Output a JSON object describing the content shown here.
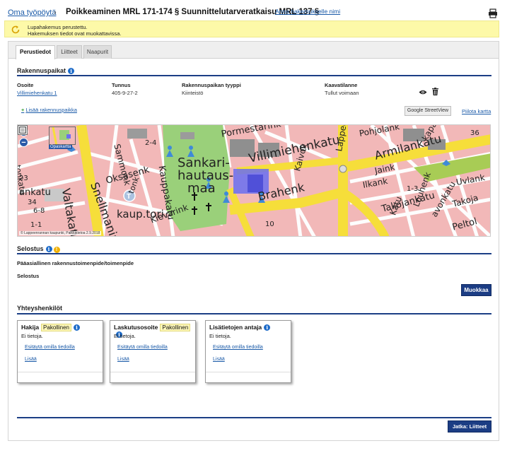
{
  "header": {
    "breadcrumb_label": "Oma työpöytä",
    "breadcrumb_sep": "›",
    "title": "Poikkeaminen MRL 171-174 § Suunnittelutarveratkaisu MRL 137 §",
    "rename_link": "Anna hakemukselle nimi",
    "print_icon": "printer-icon"
  },
  "notice": {
    "icon": "refresh-icon",
    "line1": "Lupahakemus perustettu.",
    "line2": "Hakemuksen tiedot ovat muokattavissa.",
    "background": "#fdf9a8"
  },
  "tabs": [
    {
      "label": "Perustiedot",
      "active": true
    },
    {
      "label": "Liitteet",
      "active": false
    },
    {
      "label": "Naapurit",
      "active": false
    }
  ],
  "rakennuspaikat": {
    "title": "Rakennuspaikat",
    "columns": [
      "Osoite",
      "Tunnus",
      "Rakennuspaikan tyyppi",
      "Kaavatilanne"
    ],
    "row": {
      "osoite": "Villimiehenkatu 1",
      "tunnus": "405-9-27-2",
      "tyyppi": "Kiinteistö",
      "kaava": "Tullut voimaan"
    },
    "add_link": "Lisää rakennuspaikka",
    "streetview_button": "Google StreetView",
    "hide_map_link": "Piilota kartta"
  },
  "map": {
    "overview_label": "Opaskartta",
    "credit": "© Lappeenrannan kaupunki, Paikkatietoa 2.9.2018",
    "labels": {
      "sankari": "Sankari-",
      "hautaus": "hautaus-",
      "maa": "maa",
      "villimiehenkatu": "Villimiehenkatu",
      "armilankatu": "Armilankatu",
      "brahenk": "Brahenk",
      "snellmanink": "Snellmanink",
      "valtakatu": "Valtakatu",
      "kauppakatu": "Kauppakatu",
      "pormestarink": "Pormestarink",
      "oksasenk": "Oksasenk",
      "kievarink": "Kievarink",
      "kauptori": "kaup.tori",
      "sammonk": "Sammonk",
      "lappee": "Lappee",
      "takojankatu": "Takojankatu",
      "ilkank": "Ilkank",
      "louhenk": "Louhenk",
      "kaivok": "Kaivok",
      "pohjolank": "Pohjolank",
      "kapakatu": "kapakatu",
      "ankatu": "ankatu",
      "peltolank": "Peltol",
      "luvlankatu": "Uvlank",
      "jaink": "Jaink",
      "takojanku": "Takoja",
      "katu": "Katu",
      "savonkatu": "avonkatu",
      "tonk": "tonk",
      "tonkatu": "tonkatu",
      "number_36": "36",
      "number_34": "34",
      "number_23": "23",
      "number_10": "10",
      "number_6_8": "6-8",
      "number_1_1": "1-1",
      "number_2_4": "2-4",
      "number_1_3": "1-3"
    }
  },
  "selostus": {
    "title": "Selostus",
    "label1": "Pääasiallinen rakennustoimenpide/toimenpide",
    "label2": "Selostus",
    "edit_button": "Muokkaa"
  },
  "yhteyshenkilot": {
    "title": "Yhteyshenkilöt",
    "cards": [
      {
        "title": "Hakija",
        "badge": "Pakollinen",
        "none": "Ei tietoja.",
        "fill": "Esitäytä omilla tiedoilla",
        "add": "Lisää"
      },
      {
        "title": "Laskutusosoite",
        "badge": "Pakollinen",
        "none": "Ei tietoja.",
        "fill": "Esitäytä omilla tiedoilla",
        "add": "Lisää"
      },
      {
        "title": "Lisätietojen antaja",
        "badge": "",
        "none": "Ei tietoja.",
        "fill": "Esitäytä omilla tiedoilla",
        "add": "Lisää"
      }
    ]
  },
  "footer": {
    "continue_button": "Jatka: Liitteet"
  },
  "colors": {
    "accent": "#1c3d84",
    "link": "#1a5aa8",
    "info": "#1d6bc9",
    "warning": "#f0b000"
  }
}
